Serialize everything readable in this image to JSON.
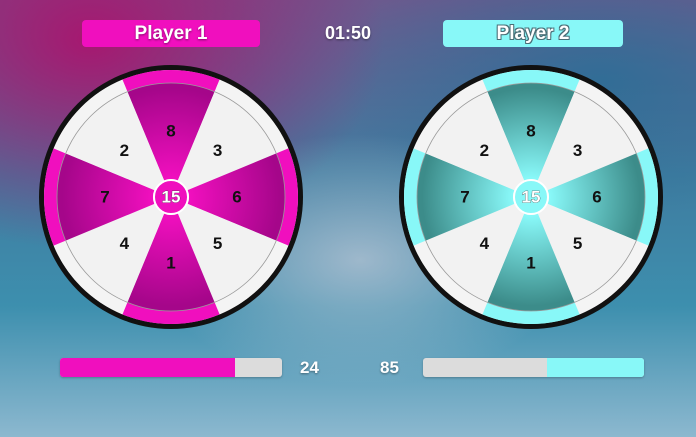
{
  "players": [
    {
      "label": "Player 1",
      "color": "#f00fbe",
      "shade": "#a5068a",
      "score": "24",
      "progress": 0.79,
      "segments": [
        "8",
        "3",
        "6",
        "5",
        "1",
        "4",
        "7",
        "2"
      ],
      "center": "15"
    },
    {
      "label": "Player 2",
      "color": "#88f8f8",
      "shade": "#3c8c8a",
      "score": "85",
      "progress": 0.44,
      "segments": [
        "8",
        "3",
        "6",
        "5",
        "1",
        "4",
        "7",
        "2"
      ],
      "center": "15"
    }
  ],
  "timer": "01:50"
}
